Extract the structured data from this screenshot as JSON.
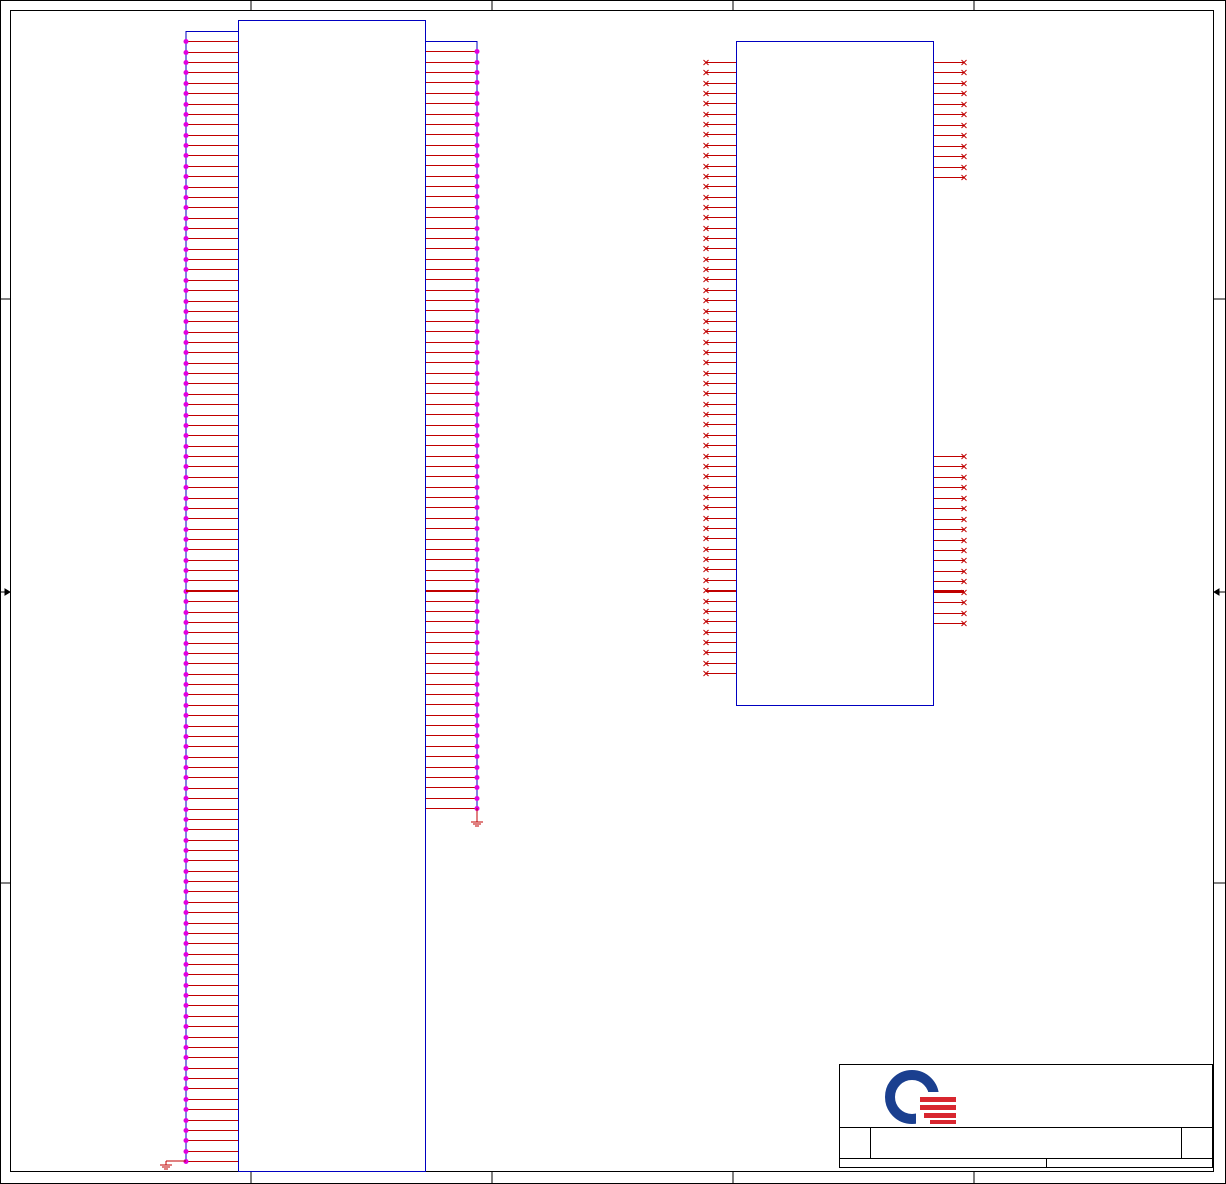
{
  "sheet": {
    "colors": {
      "border": "#000000",
      "symbol": "#0000c0",
      "pin": "#c00000",
      "junction": "#e000e0",
      "logo_blue": "#1a3f8f",
      "logo_red": "#d8262f"
    },
    "title_block": {
      "logo": "quanta-logo-icon"
    }
  },
  "parts": {
    "connector_left": {
      "left_pins": 110,
      "right_pins": 75,
      "left_junctions": true,
      "right_junctions": true
    },
    "chip_right": {
      "left_pins": 60,
      "right_top_pins": 12,
      "right_bottom_pins": 17,
      "no_connect_marks": true
    }
  }
}
